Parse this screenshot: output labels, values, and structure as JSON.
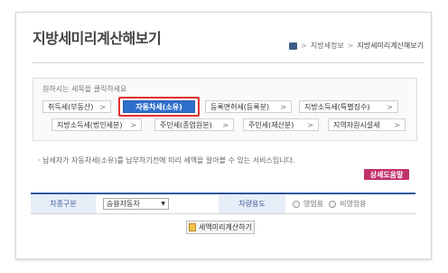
{
  "page": {
    "title": "지방세미리계산해보기",
    "breadcrumb": {
      "sep1": ">",
      "item1": "지방세정보",
      "sep2": ">",
      "current": "지방세미리계산해보기"
    }
  },
  "tax_selector": {
    "instruction": "원하시는 세목을 클릭하세요",
    "items": [
      {
        "label": "취득세(부동산)",
        "chevron": ">"
      },
      {
        "label": "자동차세(소유)",
        "chevron": ""
      },
      {
        "label": "등록면허세(등록분)",
        "chevron": ">"
      },
      {
        "label": "지방소득세(특별징수)",
        "chevron": ">"
      },
      {
        "label": "지방소득세(법인세분)",
        "chevron": ">"
      },
      {
        "label": "주민세(종업원분)",
        "chevron": ">"
      },
      {
        "label": "주민세(재산분)",
        "chevron": ">"
      },
      {
        "label": "지역자원시설세",
        "chevron": ">"
      }
    ],
    "selected_index": 1,
    "active_color": "#2f6fcc",
    "highlight_color": "#e03030"
  },
  "description": "· 납세자가 자동차세(소유)를 납부하기전에 미리 세액을 알아볼 수 있는 서비스입니다.",
  "help_button": {
    "label": "상세도움말",
    "color": "#c0306a"
  },
  "form": {
    "vehicle_type_label": "차종구분",
    "vehicle_type_value": "승용자동차",
    "dropdown_arrow": "▼",
    "usage_label": "차량용도",
    "usage_options": [
      "영업용",
      "비영업용"
    ]
  },
  "calc_button": {
    "label": "세액미리계산하기"
  }
}
